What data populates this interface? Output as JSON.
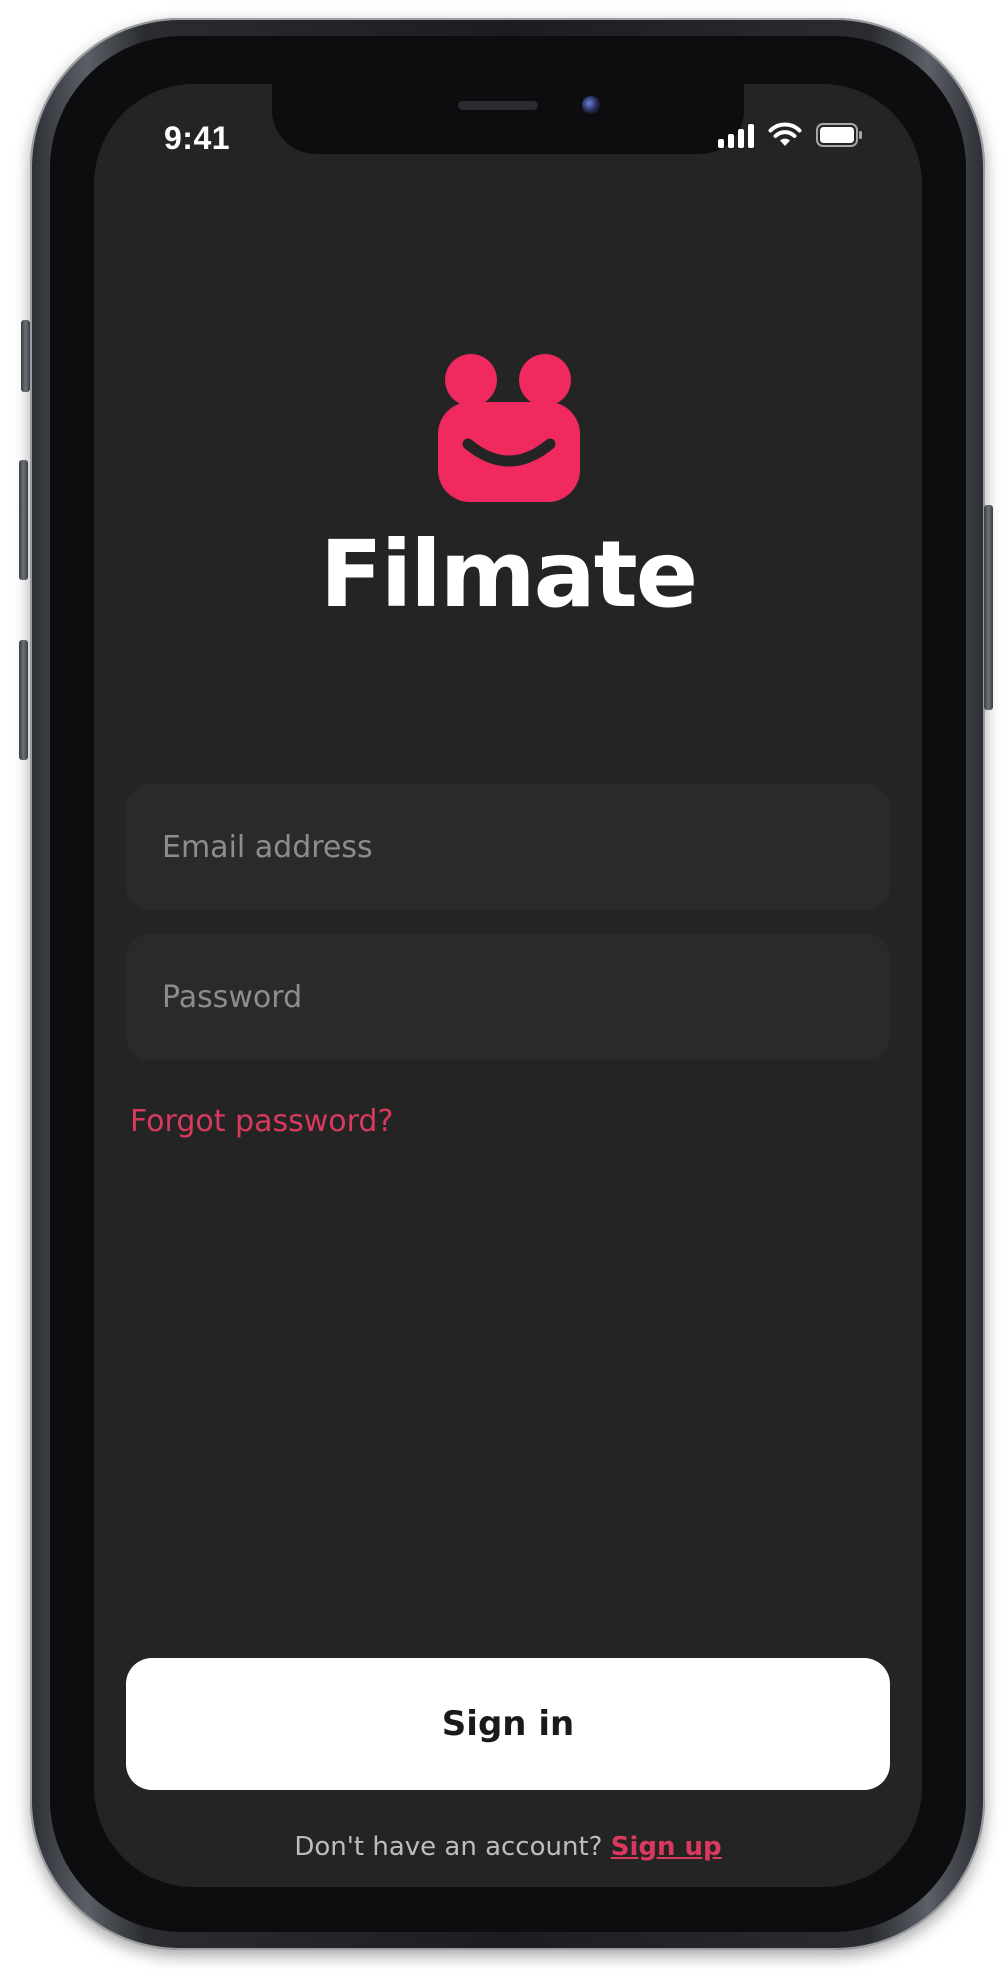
{
  "status_bar": {
    "time": "9:41",
    "icons": [
      "signal-icon",
      "wifi-icon",
      "battery-icon"
    ]
  },
  "brand": {
    "app_name": "Filmate",
    "logo_icon": "smiley-camera-logo-icon",
    "accent_color": "#F0295E"
  },
  "form": {
    "email_placeholder": "Email address",
    "email_value": "",
    "password_placeholder": "Password",
    "password_value": "",
    "forgot_label": "Forgot password?"
  },
  "actions": {
    "signin_label": "Sign in",
    "signup_prompt": "Don't have an account? ",
    "signup_label": "Sign up"
  },
  "colors": {
    "screen_background": "#242424",
    "field_background": "#2A2A2A",
    "link": "#D9395C",
    "button_background": "#FFFFFF"
  }
}
